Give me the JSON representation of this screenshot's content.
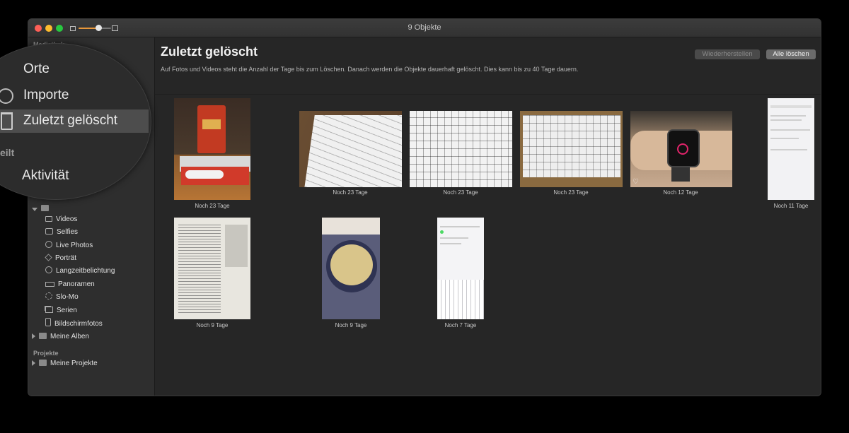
{
  "window": {
    "title": "9 Objekte",
    "zoom_level": 0.6,
    "accent": "#e8973a"
  },
  "sidebar": {
    "section_mediathek": "Mediathek",
    "section_projekte": "Projekte",
    "media_types": [
      {
        "label": "Videos",
        "icon": "video-icon"
      },
      {
        "label": "Selfies",
        "icon": "selfie-camera-icon"
      },
      {
        "label": "Live Photos",
        "icon": "live-photo-icon"
      },
      {
        "label": "Porträt",
        "icon": "portrait-cube-icon"
      },
      {
        "label": "Langzeitbelichtung",
        "icon": "long-exposure-icon"
      },
      {
        "label": "Panoramen",
        "icon": "panorama-icon"
      },
      {
        "label": "Slo-Mo",
        "icon": "slomo-icon"
      },
      {
        "label": "Serien",
        "icon": "burst-icon"
      },
      {
        "label": "Bildschirmfotos",
        "icon": "screenshot-icon"
      }
    ],
    "my_albums": "Meine Alben",
    "my_projects": "Meine Projekte"
  },
  "magnifier": {
    "items": [
      "Orte",
      "Importe",
      "Zuletzt gelöscht"
    ],
    "section_shared_partial": "eilt",
    "activity": "Aktivität"
  },
  "main": {
    "title": "Zuletzt gelöscht",
    "subtitle": "Auf Fotos und Videos steht die Anzahl der Tage bis zum Löschen. Danach werden die Objekte dauerhaft gelöscht. Dies kann bis zu 40 Tage dauern.",
    "restore_button": "Wiederherstellen",
    "delete_all_button": "Alle löschen",
    "photos": [
      {
        "caption": "Noch 23 Tage",
        "subject": "snack"
      },
      {
        "caption": "Noch 23 Tage",
        "subject": "keyboard"
      },
      {
        "caption": "Noch 23 Tage",
        "subject": "keyboard"
      },
      {
        "caption": "Noch 23 Tage",
        "subject": "keyboard"
      },
      {
        "caption": "Noch 12 Tage",
        "subject": "watch"
      },
      {
        "caption": "Noch 11 Tage",
        "subject": "screenshot"
      },
      {
        "caption": "Noch 9 Tage",
        "subject": "newspaper"
      },
      {
        "caption": "Noch 9 Tage",
        "subject": "dough"
      },
      {
        "caption": "Noch 7 Tage",
        "subject": "screenshot"
      }
    ]
  }
}
